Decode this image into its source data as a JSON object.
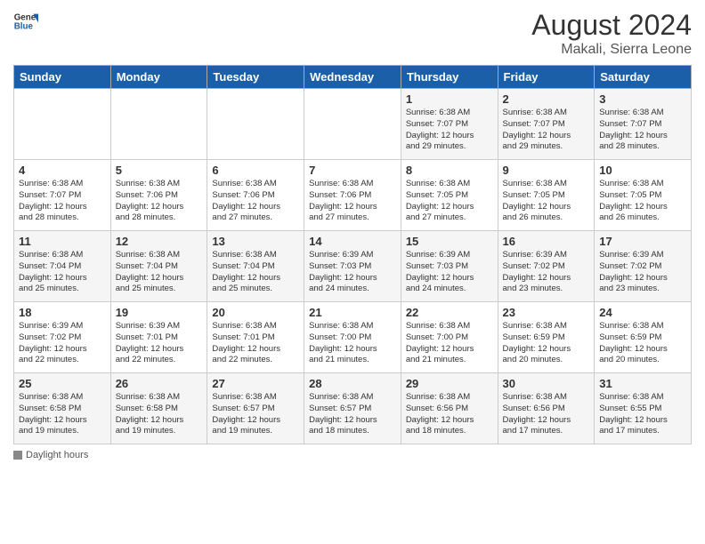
{
  "header": {
    "logo_line1": "General",
    "logo_line2": "Blue",
    "month_year": "August 2024",
    "location": "Makali, Sierra Leone"
  },
  "weekdays": [
    "Sunday",
    "Monday",
    "Tuesday",
    "Wednesday",
    "Thursday",
    "Friday",
    "Saturday"
  ],
  "weeks": [
    [
      {
        "day": "",
        "info": ""
      },
      {
        "day": "",
        "info": ""
      },
      {
        "day": "",
        "info": ""
      },
      {
        "day": "",
        "info": ""
      },
      {
        "day": "1",
        "info": "Sunrise: 6:38 AM\nSunset: 7:07 PM\nDaylight: 12 hours\nand 29 minutes."
      },
      {
        "day": "2",
        "info": "Sunrise: 6:38 AM\nSunset: 7:07 PM\nDaylight: 12 hours\nand 29 minutes."
      },
      {
        "day": "3",
        "info": "Sunrise: 6:38 AM\nSunset: 7:07 PM\nDaylight: 12 hours\nand 28 minutes."
      }
    ],
    [
      {
        "day": "4",
        "info": "Sunrise: 6:38 AM\nSunset: 7:07 PM\nDaylight: 12 hours\nand 28 minutes."
      },
      {
        "day": "5",
        "info": "Sunrise: 6:38 AM\nSunset: 7:06 PM\nDaylight: 12 hours\nand 28 minutes."
      },
      {
        "day": "6",
        "info": "Sunrise: 6:38 AM\nSunset: 7:06 PM\nDaylight: 12 hours\nand 27 minutes."
      },
      {
        "day": "7",
        "info": "Sunrise: 6:38 AM\nSunset: 7:06 PM\nDaylight: 12 hours\nand 27 minutes."
      },
      {
        "day": "8",
        "info": "Sunrise: 6:38 AM\nSunset: 7:05 PM\nDaylight: 12 hours\nand 27 minutes."
      },
      {
        "day": "9",
        "info": "Sunrise: 6:38 AM\nSunset: 7:05 PM\nDaylight: 12 hours\nand 26 minutes."
      },
      {
        "day": "10",
        "info": "Sunrise: 6:38 AM\nSunset: 7:05 PM\nDaylight: 12 hours\nand 26 minutes."
      }
    ],
    [
      {
        "day": "11",
        "info": "Sunrise: 6:38 AM\nSunset: 7:04 PM\nDaylight: 12 hours\nand 25 minutes."
      },
      {
        "day": "12",
        "info": "Sunrise: 6:38 AM\nSunset: 7:04 PM\nDaylight: 12 hours\nand 25 minutes."
      },
      {
        "day": "13",
        "info": "Sunrise: 6:38 AM\nSunset: 7:04 PM\nDaylight: 12 hours\nand 25 minutes."
      },
      {
        "day": "14",
        "info": "Sunrise: 6:39 AM\nSunset: 7:03 PM\nDaylight: 12 hours\nand 24 minutes."
      },
      {
        "day": "15",
        "info": "Sunrise: 6:39 AM\nSunset: 7:03 PM\nDaylight: 12 hours\nand 24 minutes."
      },
      {
        "day": "16",
        "info": "Sunrise: 6:39 AM\nSunset: 7:02 PM\nDaylight: 12 hours\nand 23 minutes."
      },
      {
        "day": "17",
        "info": "Sunrise: 6:39 AM\nSunset: 7:02 PM\nDaylight: 12 hours\nand 23 minutes."
      }
    ],
    [
      {
        "day": "18",
        "info": "Sunrise: 6:39 AM\nSunset: 7:02 PM\nDaylight: 12 hours\nand 22 minutes."
      },
      {
        "day": "19",
        "info": "Sunrise: 6:39 AM\nSunset: 7:01 PM\nDaylight: 12 hours\nand 22 minutes."
      },
      {
        "day": "20",
        "info": "Sunrise: 6:38 AM\nSunset: 7:01 PM\nDaylight: 12 hours\nand 22 minutes."
      },
      {
        "day": "21",
        "info": "Sunrise: 6:38 AM\nSunset: 7:00 PM\nDaylight: 12 hours\nand 21 minutes."
      },
      {
        "day": "22",
        "info": "Sunrise: 6:38 AM\nSunset: 7:00 PM\nDaylight: 12 hours\nand 21 minutes."
      },
      {
        "day": "23",
        "info": "Sunrise: 6:38 AM\nSunset: 6:59 PM\nDaylight: 12 hours\nand 20 minutes."
      },
      {
        "day": "24",
        "info": "Sunrise: 6:38 AM\nSunset: 6:59 PM\nDaylight: 12 hours\nand 20 minutes."
      }
    ],
    [
      {
        "day": "25",
        "info": "Sunrise: 6:38 AM\nSunset: 6:58 PM\nDaylight: 12 hours\nand 19 minutes."
      },
      {
        "day": "26",
        "info": "Sunrise: 6:38 AM\nSunset: 6:58 PM\nDaylight: 12 hours\nand 19 minutes."
      },
      {
        "day": "27",
        "info": "Sunrise: 6:38 AM\nSunset: 6:57 PM\nDaylight: 12 hours\nand 19 minutes."
      },
      {
        "day": "28",
        "info": "Sunrise: 6:38 AM\nSunset: 6:57 PM\nDaylight: 12 hours\nand 18 minutes."
      },
      {
        "day": "29",
        "info": "Sunrise: 6:38 AM\nSunset: 6:56 PM\nDaylight: 12 hours\nand 18 minutes."
      },
      {
        "day": "30",
        "info": "Sunrise: 6:38 AM\nSunset: 6:56 PM\nDaylight: 12 hours\nand 17 minutes."
      },
      {
        "day": "31",
        "info": "Sunrise: 6:38 AM\nSunset: 6:55 PM\nDaylight: 12 hours\nand 17 minutes."
      }
    ]
  ],
  "legend": {
    "label": "Daylight hours"
  }
}
